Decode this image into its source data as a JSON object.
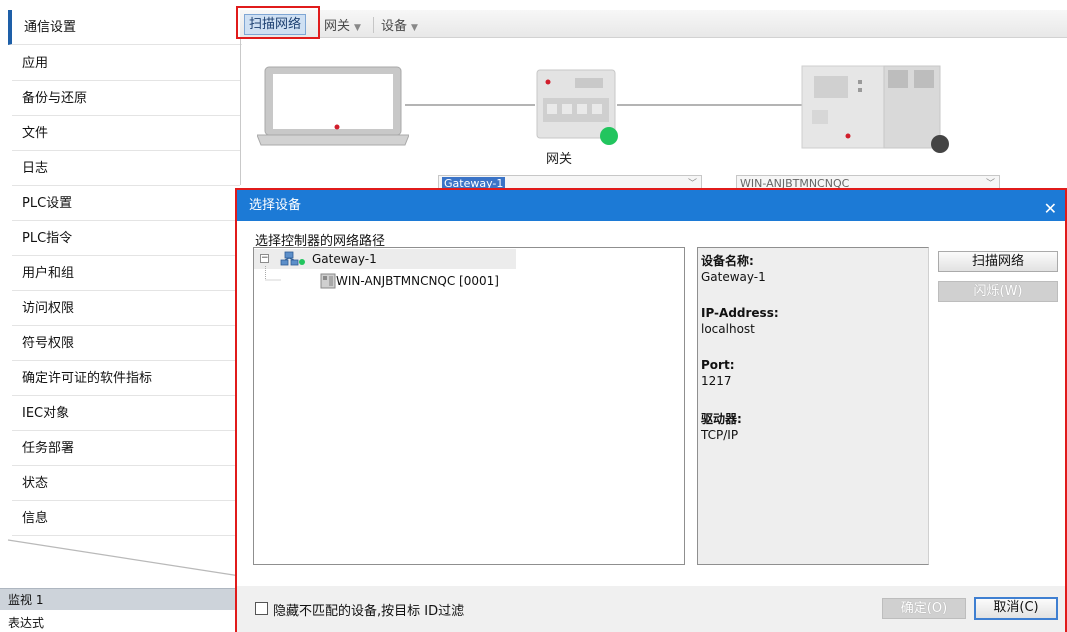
{
  "sidebar": {
    "items": [
      {
        "label": "通信设置",
        "active": true
      },
      {
        "label": "应用"
      },
      {
        "label": "备份与还原"
      },
      {
        "label": "文件"
      },
      {
        "label": "日志"
      },
      {
        "label": "PLC设置"
      },
      {
        "label": "PLC指令"
      },
      {
        "label": "用户和组"
      },
      {
        "label": "访问权限"
      },
      {
        "label": "符号权限"
      },
      {
        "label": "确定许可证的软件指标"
      },
      {
        "label": "IEC对象"
      },
      {
        "label": "任务部署"
      },
      {
        "label": "状态"
      },
      {
        "label": "信息"
      }
    ]
  },
  "bottom": {
    "watch_label": "监视 1",
    "expression_label": "表达式"
  },
  "toolbar": {
    "scan_label": "扫描网络",
    "gateway_label": "网关",
    "device_label": "设备"
  },
  "network": {
    "gateway_label": "网关",
    "gateway_dropdown": "Gateway-1",
    "device_dropdown": "WIN-ANJBTMNCNQC",
    "gateway_status_color": "#22c55e",
    "device_status_color": "#444444"
  },
  "dialog": {
    "title": "选择设备",
    "path_label": "选择控制器的网络路径",
    "tree": [
      {
        "label": "Gateway-1",
        "icon": "gateway-icon",
        "expanded": true,
        "status_color": "#22c55e"
      },
      {
        "label": "WIN-ANJBTMNCNQC [0001]",
        "icon": "plc-device-icon"
      }
    ],
    "info": {
      "device_name_key": "设备名称:",
      "device_name_val": "Gateway-1",
      "ip_key": "IP-Address:",
      "ip_val": "localhost",
      "port_key": "Port:",
      "port_val": "1217",
      "driver_key": "驱动器:",
      "driver_val": "TCP/IP"
    },
    "buttons": {
      "scan": "扫描网络",
      "wink": "闪烁(W)",
      "ok": "确定(O)",
      "cancel": "取消(C)"
    },
    "hide_label": "隐藏不匹配的设备,按目标 ID过滤"
  }
}
